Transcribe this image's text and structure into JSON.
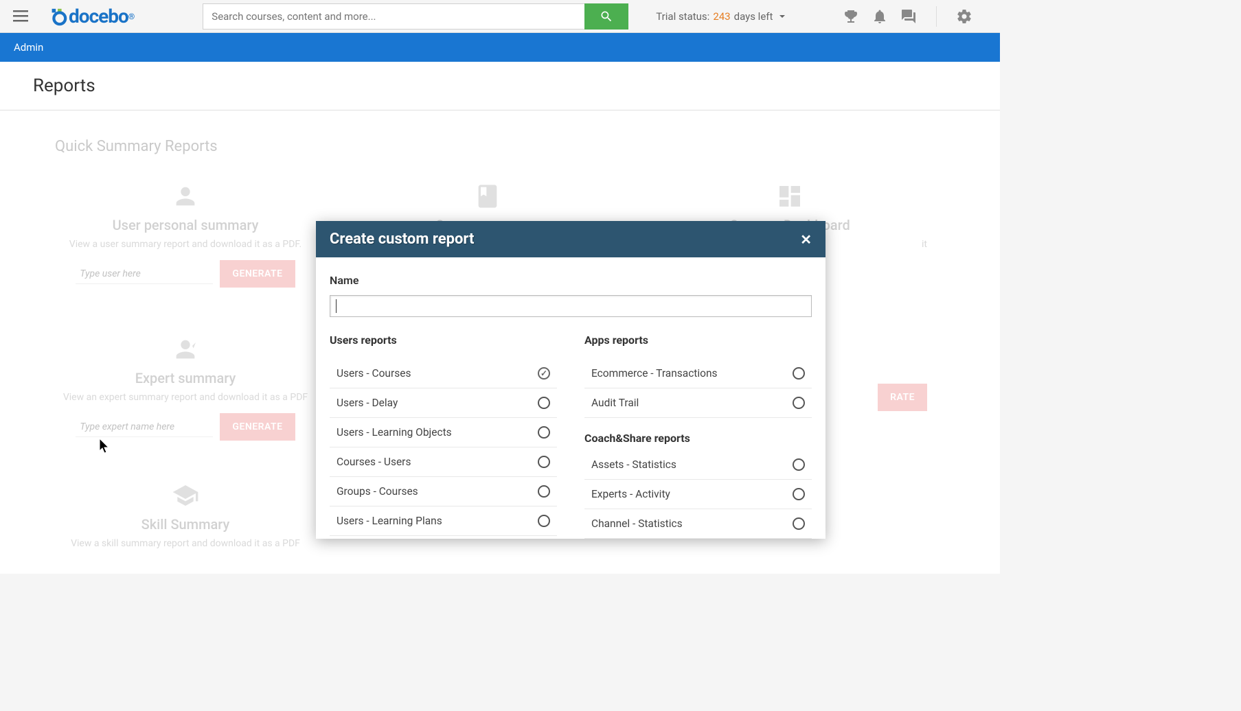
{
  "topbar": {
    "brand": "docebo",
    "search_placeholder": "Search courses, content and more...",
    "trial_prefix": "Trial status:",
    "trial_days": "243",
    "trial_suffix": "days left"
  },
  "breadcrumb": "Admin",
  "page_title": "Reports",
  "sections": {
    "quick_summary_title": "Quick Summary Reports"
  },
  "cards": {
    "user_personal": {
      "title": "User personal summary",
      "desc": "View a user summary report and download it as a PDF.",
      "placeholder": "Type user here",
      "button": "GENERATE"
    },
    "course": {
      "title": "Course summary"
    },
    "dashboard": {
      "title": "Courses Dashboard",
      "desc_tail": "it"
    },
    "expert": {
      "title": "Expert summary",
      "desc": "View an expert summary report and download it as a PDF",
      "placeholder": "Type expert name here",
      "button": "GENERATE"
    },
    "skill": {
      "title": "Skill Summary",
      "desc": "View a skill summary report and download it as a PDF"
    },
    "generate_btn_r": "RATE"
  },
  "modal": {
    "title": "Create custom report",
    "name_label": "Name",
    "users_reports_heading": "Users reports",
    "apps_reports_heading": "Apps reports",
    "coach_share_heading": "Coach&Share reports",
    "users_options": [
      {
        "label": "Users - Courses",
        "selected": true
      },
      {
        "label": "Users - Delay",
        "selected": false
      },
      {
        "label": "Users - Learning Objects",
        "selected": false
      },
      {
        "label": "Courses - Users",
        "selected": false
      },
      {
        "label": "Groups - Courses",
        "selected": false
      },
      {
        "label": "Users - Learning Plans",
        "selected": false
      }
    ],
    "apps_options": [
      {
        "label": "Ecommerce - Transactions",
        "selected": false
      },
      {
        "label": "Audit Trail",
        "selected": false
      }
    ],
    "coach_options": [
      {
        "label": "Assets - Statistics",
        "selected": false
      },
      {
        "label": "Experts - Activity",
        "selected": false
      },
      {
        "label": "Channel - Statistics",
        "selected": false
      }
    ]
  }
}
